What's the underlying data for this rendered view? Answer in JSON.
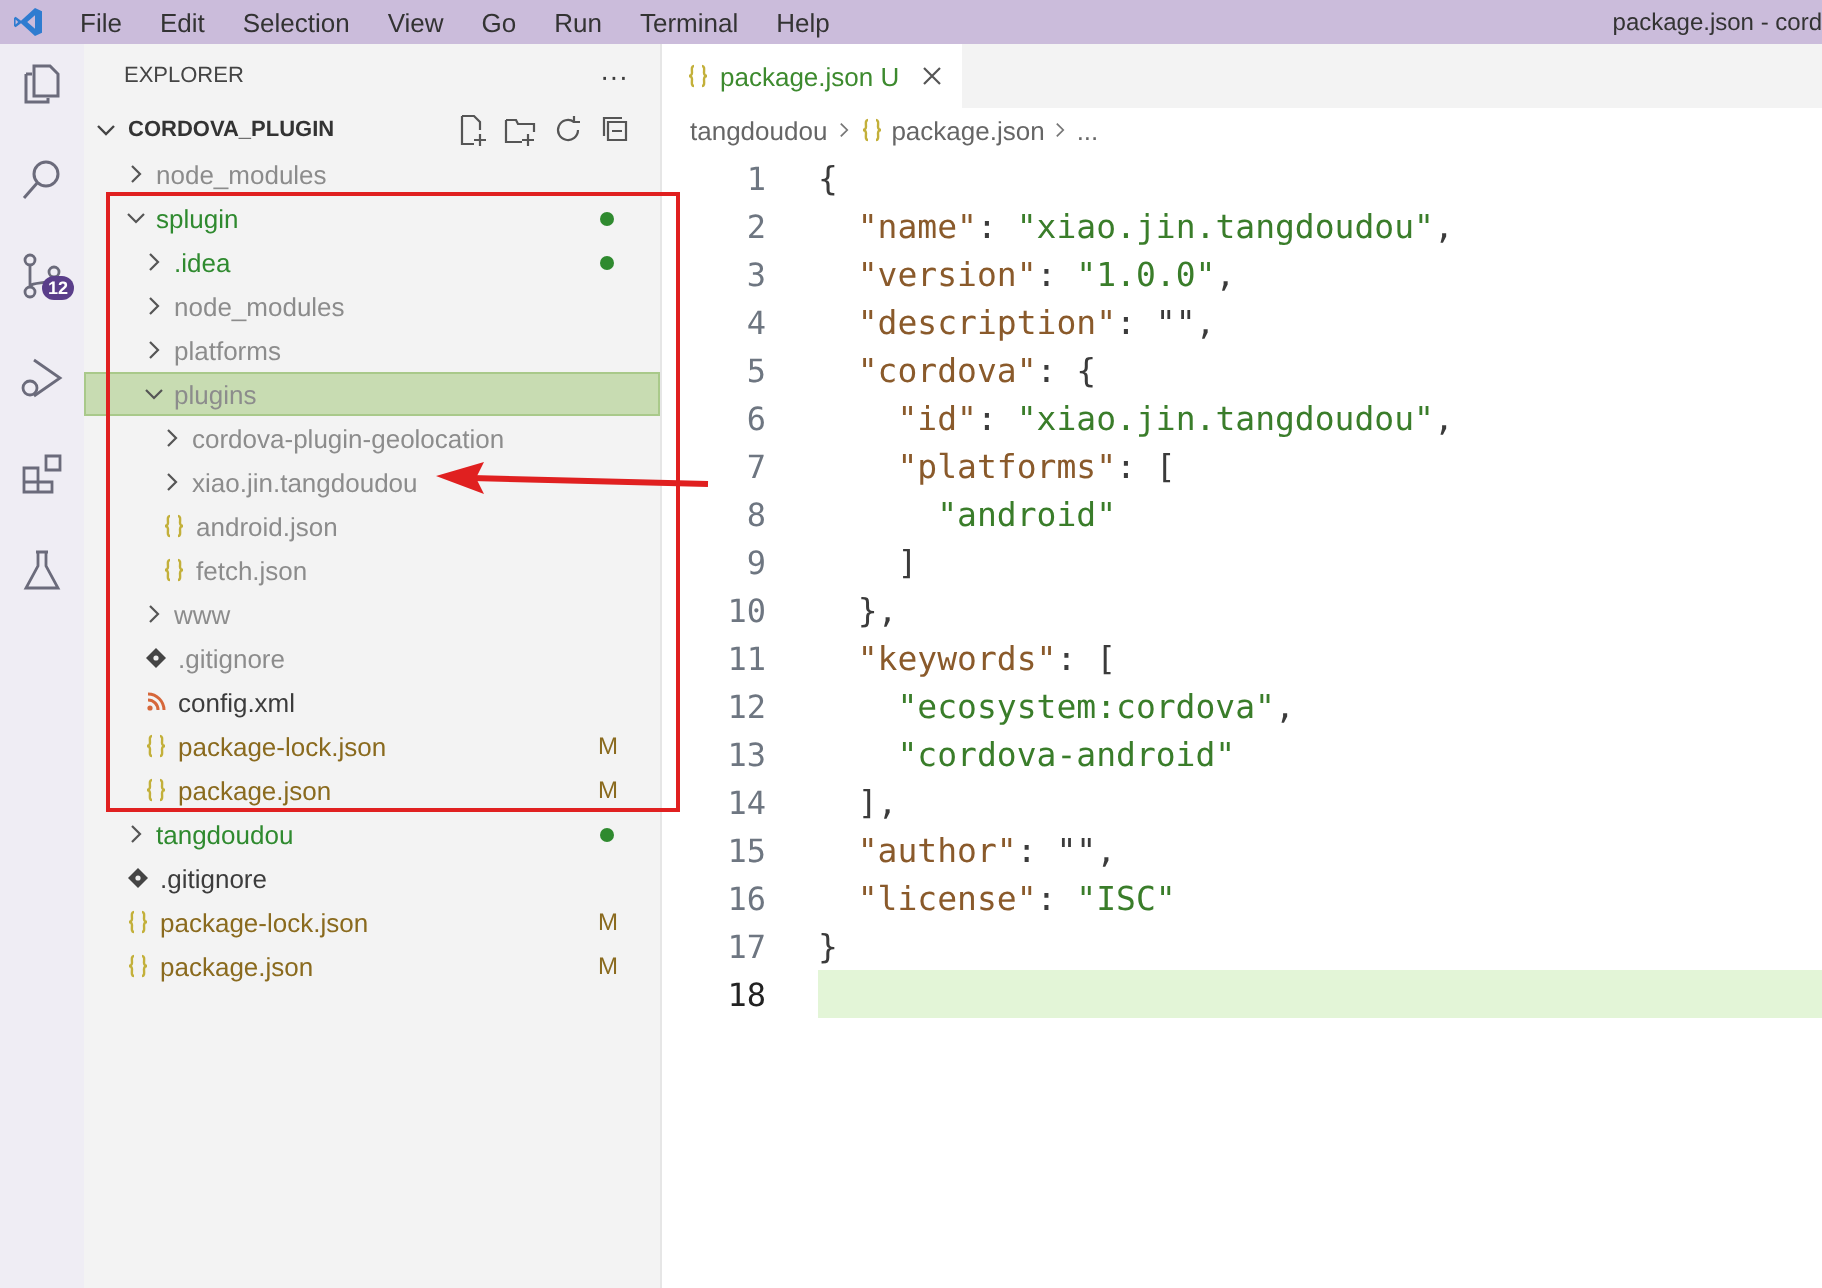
{
  "menu": [
    "File",
    "Edit",
    "Selection",
    "View",
    "Go",
    "Run",
    "Terminal",
    "Help"
  ],
  "window": {
    "title": "package.json - cord"
  },
  "activity_bar": {
    "source_control_badge": "12"
  },
  "explorer": {
    "title": "EXPLORER",
    "more": "···",
    "root": {
      "label": "CORDOVA_PLUGIN",
      "expanded": true
    },
    "items": [
      {
        "label": "node_modules",
        "kind": "folder",
        "color": "#8c8c8c",
        "expanded": false,
        "selected": false,
        "dot": false
      },
      {
        "label": "splugin",
        "kind": "folder",
        "color": "#2f8a2f",
        "expanded": true,
        "selected": false,
        "dot": true,
        "children": [
          {
            "label": ".idea",
            "kind": "folder",
            "color": "#2f8a2f",
            "expanded": false,
            "selected": false,
            "dot": true
          },
          {
            "label": "node_modules",
            "kind": "folder",
            "color": "#8c8c8c",
            "expanded": false,
            "selected": false,
            "dot": false
          },
          {
            "label": "platforms",
            "kind": "folder",
            "color": "#8c8c8c",
            "expanded": false,
            "selected": false,
            "dot": false
          },
          {
            "label": "plugins",
            "kind": "folder",
            "color": "#8c8c8c",
            "expanded": true,
            "selected": true,
            "dot": false,
            "children": [
              {
                "label": "cordova-plugin-geolocation",
                "kind": "folder",
                "color": "#8c8c8c",
                "expanded": false,
                "selected": false,
                "dot": false
              },
              {
                "label": "xiao.jin.tangdoudou",
                "kind": "folder",
                "color": "#8c8c8c",
                "expanded": false,
                "selected": false,
                "dot": false
              },
              {
                "label": "android.json",
                "kind": "json",
                "color": "#8c8c8c",
                "selected": false,
                "dot": false
              },
              {
                "label": "fetch.json",
                "kind": "json",
                "color": "#8c8c8c",
                "selected": false,
                "dot": false
              }
            ]
          },
          {
            "label": "www",
            "kind": "folder",
            "color": "#8c8c8c",
            "expanded": false,
            "selected": false,
            "dot": false
          },
          {
            "label": ".gitignore",
            "kind": "git",
            "color": "#8c8c8c",
            "selected": false,
            "dot": false
          },
          {
            "label": "config.xml",
            "kind": "xml",
            "color": "#3c3c3c",
            "selected": false,
            "dot": false
          },
          {
            "label": "package-lock.json",
            "kind": "json",
            "color": "#8a6a1e",
            "selected": false,
            "dot": false,
            "badge": "M"
          },
          {
            "label": "package.json",
            "kind": "json",
            "color": "#8a6a1e",
            "selected": false,
            "dot": false,
            "badge": "M"
          }
        ]
      },
      {
        "label": "tangdoudou",
        "kind": "folder",
        "color": "#2f8a2f",
        "expanded": false,
        "selected": false,
        "dot": true
      },
      {
        "label": ".gitignore",
        "kind": "git",
        "color": "#3c3c3c",
        "selected": false,
        "dot": false
      },
      {
        "label": "package-lock.json",
        "kind": "json",
        "color": "#8a6a1e",
        "selected": false,
        "dot": false,
        "badge": "M"
      },
      {
        "label": "package.json",
        "kind": "json",
        "color": "#8a6a1e",
        "selected": false,
        "dot": false,
        "badge": "M"
      }
    ]
  },
  "tab": {
    "label": "package.json",
    "status": "U",
    "selected": true
  },
  "breadcrumbs": {
    "folder": "tangdoudou",
    "file": "package.json",
    "more": "..."
  },
  "code": [
    {
      "number": "1",
      "current": false,
      "tokens": [
        {
          "text": "{",
          "kind": "punct"
        }
      ]
    },
    {
      "number": "2",
      "current": false,
      "tokens": [
        {
          "text": "  \"name\"",
          "kind": "key"
        },
        {
          "text": ": ",
          "kind": "punct"
        },
        {
          "text": "\"xiao.jin.tangdoudou\"",
          "kind": "string"
        },
        {
          "text": ",",
          "kind": "punct"
        }
      ]
    },
    {
      "number": "3",
      "current": false,
      "tokens": [
        {
          "text": "  \"version\"",
          "kind": "key"
        },
        {
          "text": ": ",
          "kind": "punct"
        },
        {
          "text": "\"1.0.0\"",
          "kind": "string"
        },
        {
          "text": ",",
          "kind": "punct"
        }
      ]
    },
    {
      "number": "4",
      "current": false,
      "tokens": [
        {
          "text": "  \"description\"",
          "kind": "key"
        },
        {
          "text": ": \"\",",
          "kind": "punct"
        }
      ]
    },
    {
      "number": "5",
      "current": false,
      "tokens": [
        {
          "text": "  \"cordova\"",
          "kind": "key"
        },
        {
          "text": ": {",
          "kind": "punct"
        }
      ]
    },
    {
      "number": "6",
      "current": false,
      "tokens": [
        {
          "text": "    \"id\"",
          "kind": "key"
        },
        {
          "text": ": ",
          "kind": "punct"
        },
        {
          "text": "\"xiao.jin.tangdoudou\"",
          "kind": "string"
        },
        {
          "text": ",",
          "kind": "punct"
        }
      ]
    },
    {
      "number": "7",
      "current": false,
      "tokens": [
        {
          "text": "    \"platforms\"",
          "kind": "key"
        },
        {
          "text": ": [",
          "kind": "punct"
        }
      ]
    },
    {
      "number": "8",
      "current": false,
      "tokens": [
        {
          "text": "      \"android\"",
          "kind": "string"
        }
      ]
    },
    {
      "number": "9",
      "current": false,
      "tokens": [
        {
          "text": "    ]",
          "kind": "punct"
        }
      ]
    },
    {
      "number": "10",
      "current": false,
      "tokens": [
        {
          "text": "  },",
          "kind": "punct"
        }
      ]
    },
    {
      "number": "11",
      "current": false,
      "tokens": [
        {
          "text": "  \"keywords\"",
          "kind": "key"
        },
        {
          "text": ": [",
          "kind": "punct"
        }
      ]
    },
    {
      "number": "12",
      "current": false,
      "tokens": [
        {
          "text": "    \"ecosystem:cordova\"",
          "kind": "string"
        },
        {
          "text": ",",
          "kind": "punct"
        }
      ]
    },
    {
      "number": "13",
      "current": false,
      "tokens": [
        {
          "text": "    \"cordova-android\"",
          "kind": "string"
        }
      ]
    },
    {
      "number": "14",
      "current": false,
      "tokens": [
        {
          "text": "  ],",
          "kind": "punct"
        }
      ]
    },
    {
      "number": "15",
      "current": false,
      "tokens": [
        {
          "text": "  \"author\"",
          "kind": "key"
        },
        {
          "text": ": \"\",",
          "kind": "punct"
        }
      ]
    },
    {
      "number": "16",
      "current": false,
      "tokens": [
        {
          "text": "  \"license\"",
          "kind": "key"
        },
        {
          "text": ": ",
          "kind": "punct"
        },
        {
          "text": "\"ISC\"",
          "kind": "string"
        }
      ]
    },
    {
      "number": "17",
      "current": false,
      "tokens": [
        {
          "text": "}",
          "kind": "punct"
        }
      ]
    },
    {
      "number": "18",
      "current": true
    }
  ]
}
